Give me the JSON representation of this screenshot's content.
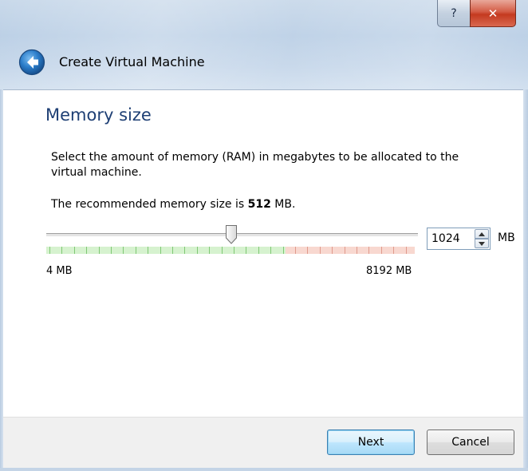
{
  "window": {
    "title": "Create Virtual Machine",
    "help_glyph": "?",
    "close_glyph": "✕",
    "back_icon": "back-arrow-icon"
  },
  "page": {
    "heading": "Memory size",
    "description": "Select the amount of memory (RAM) in megabytes to be allocated to the virtual machine.",
    "recommend_prefix": "The recommended memory size is ",
    "recommend_value": "512",
    "recommend_suffix": " MB."
  },
  "memory_slider": {
    "min_label": "4 MB",
    "max_label": "8192 MB",
    "min": 4,
    "max": 8192,
    "value": 1024,
    "recommended_fraction": 0.65
  },
  "memory_input": {
    "value": "1024",
    "unit": "MB"
  },
  "buttons": {
    "next": "Next",
    "cancel": "Cancel"
  },
  "colors": {
    "heading": "#1e3f74",
    "safe_band": "#d6f2cf",
    "warn_band": "#f8d8d0"
  }
}
